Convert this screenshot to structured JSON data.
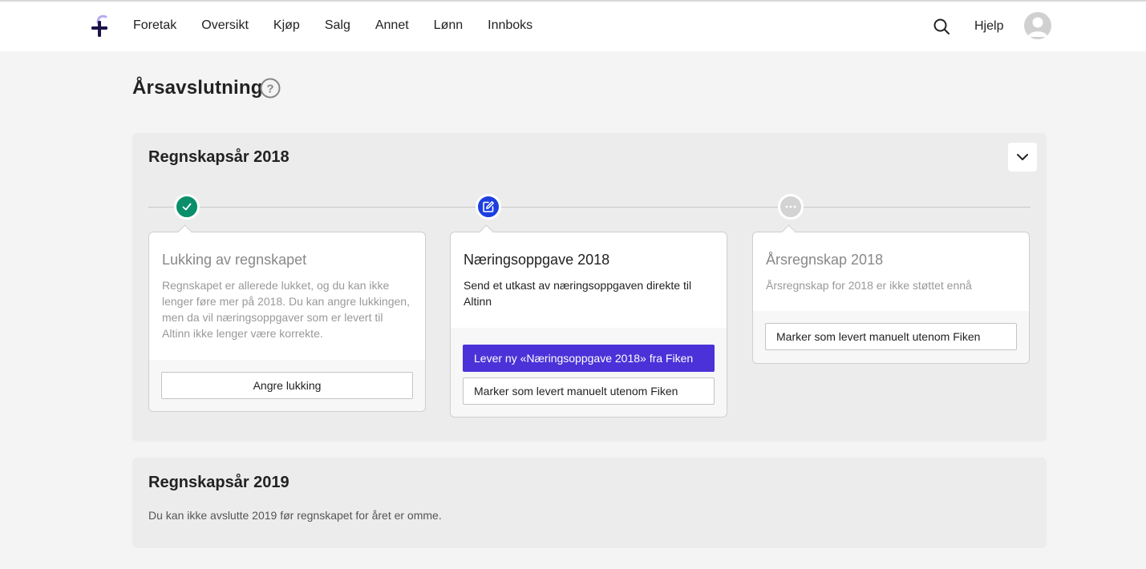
{
  "nav": {
    "items": [
      {
        "label": "Foretak"
      },
      {
        "label": "Oversikt"
      },
      {
        "label": "Kjøp"
      },
      {
        "label": "Salg"
      },
      {
        "label": "Annet"
      },
      {
        "label": "Lønn"
      },
      {
        "label": "Innboks"
      }
    ],
    "help_label": "Hjelp"
  },
  "page": {
    "title": "Årsavslutning"
  },
  "year_2018": {
    "title": "Regnskapsår 2018",
    "steps": [
      {
        "status": "done",
        "title": "Lukking av regnskapet",
        "text": "Regnskapet er allerede lukket, og du kan ikke lenger føre mer på 2018. Du kan angre lukkingen, men da vil næringsoppgaver som er levert til Altinn ikke lenger være korrekte.",
        "button": "Angre lukking"
      },
      {
        "status": "active",
        "title": "Næringsoppgave 2018",
        "text": "Send et utkast av næringsoppgaven direkte til Altinn",
        "primary_button": "Lever ny «Næringsoppgave 2018» fra Fiken",
        "secondary_button": "Marker som levert manuelt utenom Fiken"
      },
      {
        "status": "pending",
        "title": "Årsregnskap 2018",
        "text": "Årsregnskap for 2018 er ikke støttet ennå",
        "button": "Marker som levert manuelt utenom Fiken"
      }
    ]
  },
  "year_2019": {
    "title": "Regnskapsår 2019",
    "text": "Du kan ikke avslutte 2019 før regnskapet for året er omme."
  },
  "colors": {
    "accent": "#4b32d8",
    "done": "#0a8f6a",
    "active": "#1d3fe0",
    "pending": "#d3d3d3"
  },
  "icons": {
    "logo": "fiken-logo",
    "search": "search-icon",
    "avatar": "user-avatar-icon",
    "help": "question-circle-icon",
    "collapse": "chevron-down-icon",
    "done": "check-icon",
    "active": "edit-icon",
    "pending": "ellipsis-icon"
  }
}
